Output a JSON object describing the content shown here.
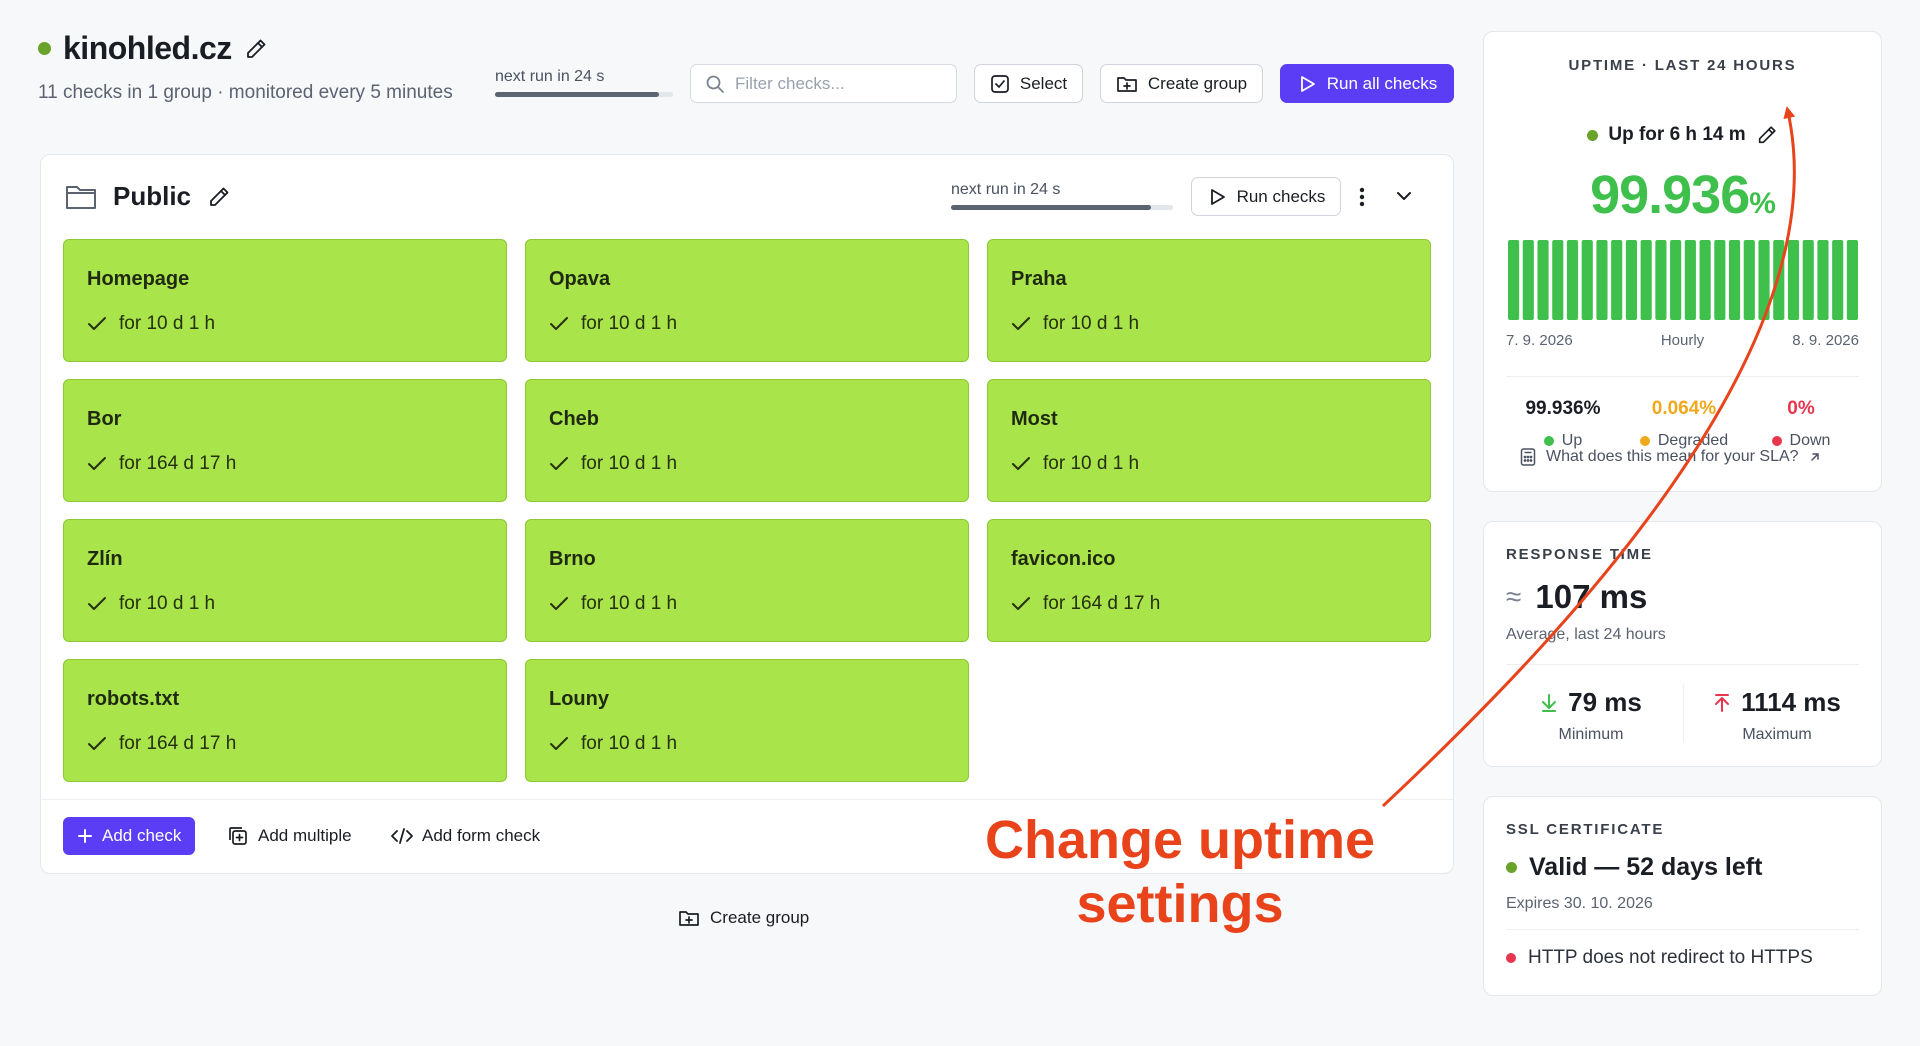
{
  "site": {
    "name": "kinohled.cz",
    "subtitle": "11 checks in 1 group · monitored every 5 minutes",
    "next_run": "next run in 24 s",
    "next_run_progress": 0.92,
    "filter_placeholder": "Filter checks...",
    "select_label": "Select",
    "create_group_label": "Create group",
    "run_all_label": "Run all checks"
  },
  "group": {
    "name": "Public",
    "next_run": "next run in 24 s",
    "next_run_progress": 0.9,
    "run_checks_label": "Run checks",
    "tiles": [
      {
        "name": "Homepage",
        "status": "for 10 d 1 h"
      },
      {
        "name": "Opava",
        "status": "for 10 d 1 h"
      },
      {
        "name": "Praha",
        "status": "for 10 d 1 h"
      },
      {
        "name": "Bor",
        "status": "for 164 d 17 h"
      },
      {
        "name": "Cheb",
        "status": "for 10 d 1 h"
      },
      {
        "name": "Most",
        "status": "for 10 d 1 h"
      },
      {
        "name": "Zlín",
        "status": "for 10 d 1 h"
      },
      {
        "name": "Brno",
        "status": "for 10 d 1 h"
      },
      {
        "name": "favicon.ico",
        "status": "for 164 d 17 h"
      },
      {
        "name": "robots.txt",
        "status": "for 164 d 17 h"
      },
      {
        "name": "Louny",
        "status": "for 10 d 1 h"
      }
    ],
    "add_check_label": "Add check",
    "add_multiple_label": "Add multiple",
    "add_form_check_label": "Add form check"
  },
  "bottom": {
    "create_group_label": "Create group"
  },
  "uptime": {
    "label": "UPTIME · LAST 24 HOURS",
    "up_for": "Up for 6 h 14 m",
    "percent": "99.936",
    "percent_sign": "%",
    "bar_count": 24,
    "axis_start": "7. 9. 2026",
    "axis_mid": "Hourly",
    "axis_end": "8. 9. 2026",
    "up_value": "99.936%",
    "up_label": "Up",
    "degraded_value": "0.064%",
    "degraded_label": "Degraded",
    "down_value": "0%",
    "down_label": "Down",
    "sla_link": "What does this mean for your SLA?"
  },
  "response": {
    "label": "RESPONSE TIME",
    "approx": "≈",
    "average": "107 ms",
    "average_sub": "Average, last 24 hours",
    "min_value": "79 ms",
    "min_label": "Minimum",
    "max_value": "1114 ms",
    "max_label": "Maximum"
  },
  "ssl": {
    "label": "SSL CERTIFICATE",
    "status": "Valid — 52 days left",
    "expires": "Expires 30. 10. 2026",
    "warning": "HTTP does not redirect to HTTPS"
  },
  "annotation": {
    "line1": "Change uptime",
    "line2": "settings"
  },
  "colors": {
    "accent": "#5b3df5",
    "tile_green": "#a9e44a",
    "uptime_green": "#3fbf4c",
    "degraded": "#f0a81c",
    "down": "#e8364f",
    "annotation": "#e8431b"
  }
}
